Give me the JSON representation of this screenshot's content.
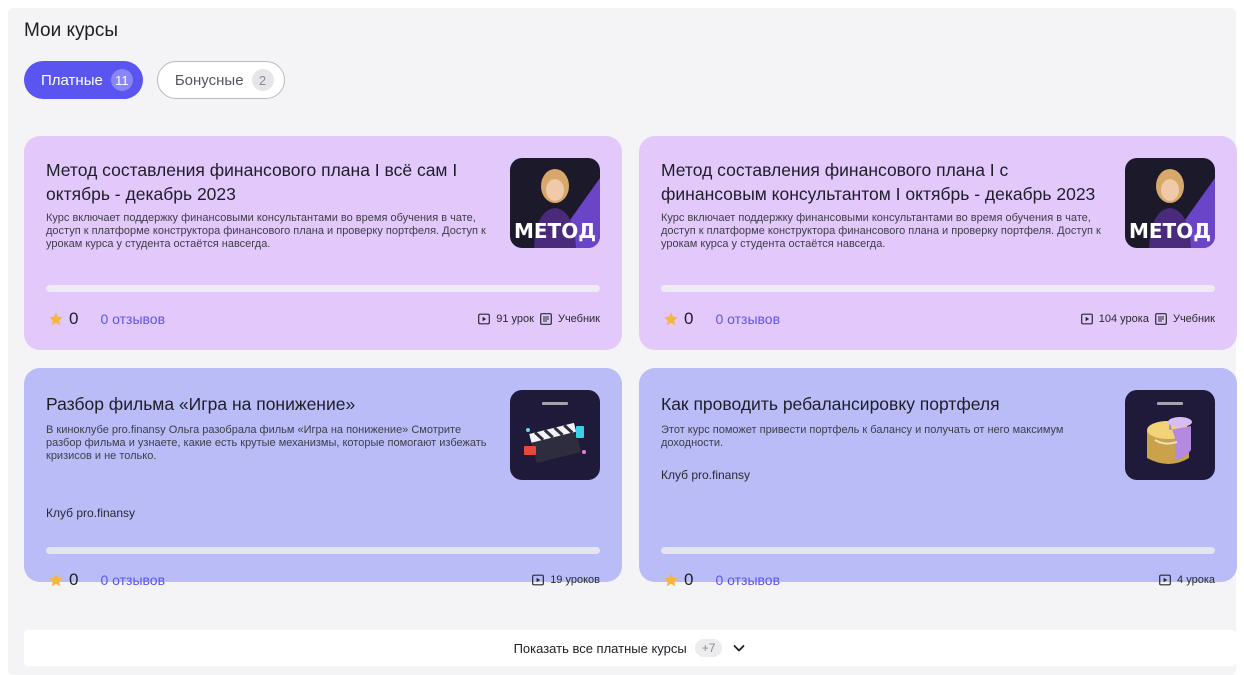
{
  "section": {
    "title": "Мои курсы"
  },
  "tabs": [
    {
      "label": "Платные",
      "count": "11",
      "active": true
    },
    {
      "label": "Бонусные",
      "count": "2",
      "active": false
    }
  ],
  "courses": [
    {
      "title": "Метод составления финансового плана I всё сам I октябрь - декабрь 2023",
      "description": "Курс включает поддержку финансовыми консультантами во время обучения в чате, доступ к платформе конструктора финансового плана и проверку портфеля. Доступ к урокам курса у студента остаётся навсегда.",
      "thumb_text": "МЕТОД",
      "rating": "0",
      "reviews": "0 отзывов",
      "lessons": "91 урок",
      "textbook": "Учебник",
      "progress": 0
    },
    {
      "title": "Метод составления финансового плана I с финансовым консультантом I октябрь - декабрь 2023",
      "description": "Курс включает поддержку финансовыми консультантами во время обучения в чате, доступ к платформе конструктора финансового плана и проверку портфеля. Доступ к урокам курса у студента остаётся навсегда.",
      "thumb_text": "МЕТОД",
      "rating": "0",
      "reviews": "0 отзывов",
      "lessons": "104 урока",
      "textbook": "Учебник",
      "progress": 0
    },
    {
      "title": "Разбор фильма «Игра на понижение»",
      "description": "В киноклубе pro.finansy Ольга разобрала фильм «Игра на понижение» Смотрите разбор фильма и узнаете, какие есть крутые механизмы, которые помогают избежать кризисов и не только.",
      "club": "Клуб pro.finansy",
      "rating": "0",
      "reviews": "0 отзывов",
      "lessons": "19 уроков",
      "progress": 0
    },
    {
      "title": "Как проводить ребалансировку портфеля",
      "description": "Этот курс поможет привести портфель к балансу и получать от него максимум доходности.",
      "club": "Клуб pro.finansy",
      "rating": "0",
      "reviews": "0 отзывов",
      "lessons": "4 урока",
      "progress": 0
    }
  ],
  "show_all": {
    "label": "Показать все платные курсы",
    "extra": "+7"
  },
  "colors": {
    "accent": "#5a55f0",
    "card_pink": "#e2c8fb",
    "card_blue": "#b9bcf6",
    "star": "#f5b63a"
  }
}
